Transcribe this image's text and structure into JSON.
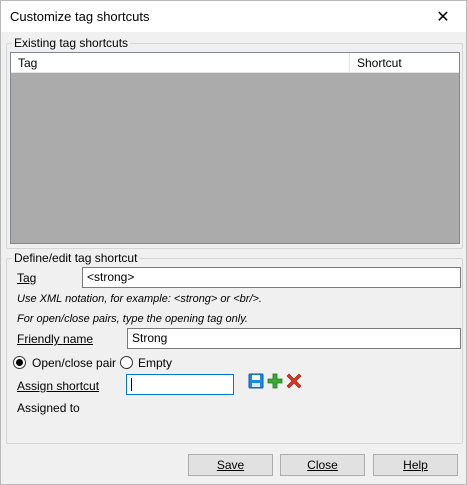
{
  "dialog": {
    "title": "Customize tag shortcuts",
    "close_glyph": "✕"
  },
  "existing": {
    "group_label": "Existing tag shortcuts",
    "columns": [
      "Tag",
      "Shortcut"
    ],
    "rows": []
  },
  "define": {
    "group_label": "Define/edit tag shortcut",
    "tag_label": "Tag",
    "tag_value": "<strong>",
    "hint1": "Use XML notation, for example: <strong> or <br/>.",
    "hint2": "For open/close pairs, type the opening tag only.",
    "friendly_label": "Friendly name",
    "friendly_value": "Strong",
    "radio_pair_label": "Open/close pair",
    "radio_empty_label": "Empty",
    "selected_type": "Open/close pair",
    "assign_label": "Assign shortcut",
    "assign_value": "",
    "assigned_to_label": "Assigned to",
    "icons": [
      "save-icon",
      "add-icon",
      "delete-icon"
    ]
  },
  "buttons": {
    "save": "Save",
    "close": "Close",
    "help": "Help"
  },
  "colors": {
    "list_background": "#ababab",
    "add_green": "#3aa935",
    "delete_red": "#d9381e",
    "save_blue": "#1e88e5"
  }
}
